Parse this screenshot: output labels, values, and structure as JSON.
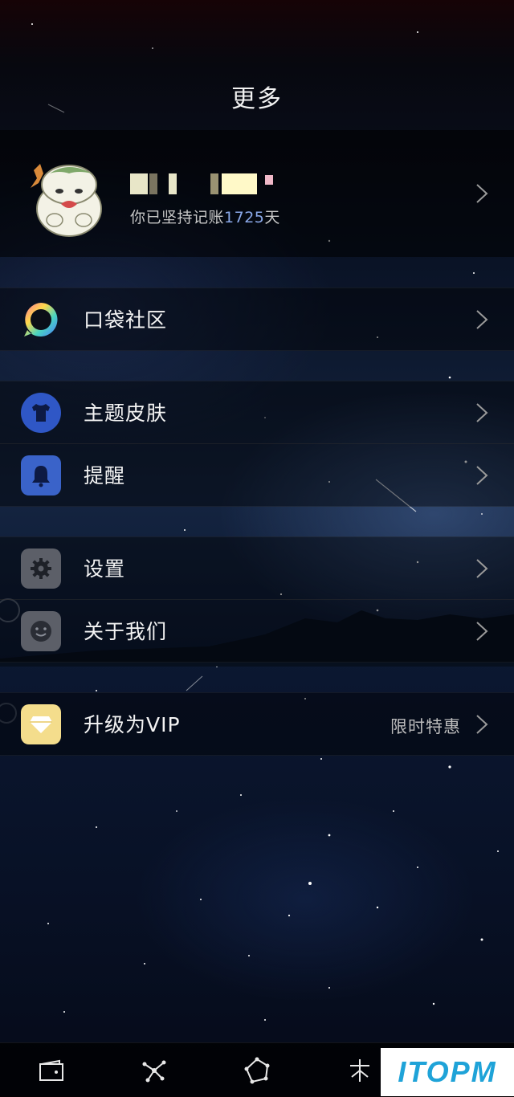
{
  "header": {
    "title": "更多"
  },
  "profile": {
    "days_prefix": "你已坚持记账",
    "days_count": "1725",
    "days_suffix": "天"
  },
  "menu": {
    "community": {
      "label": "口袋社区"
    },
    "theme": {
      "label": "主题皮肤"
    },
    "reminder": {
      "label": "提醒"
    },
    "settings": {
      "label": "设置"
    },
    "about": {
      "label": "关于我们"
    },
    "vip": {
      "label": "升级为VIP",
      "badge": "限时特惠"
    }
  },
  "bottom_nav": [
    "wallet-icon",
    "constellation-icon",
    "polygon-icon",
    "star-branch-icon"
  ],
  "watermark": {
    "text": "ITOPM"
  },
  "colors": {
    "theme_icon_bg": "#2f57c6",
    "reminder_icon_bg": "#3a63c9",
    "settings_icon_bg": "#5c5f68",
    "vip_icon_bg": "#f4dd8c",
    "days_count": "#8aa8e8"
  }
}
